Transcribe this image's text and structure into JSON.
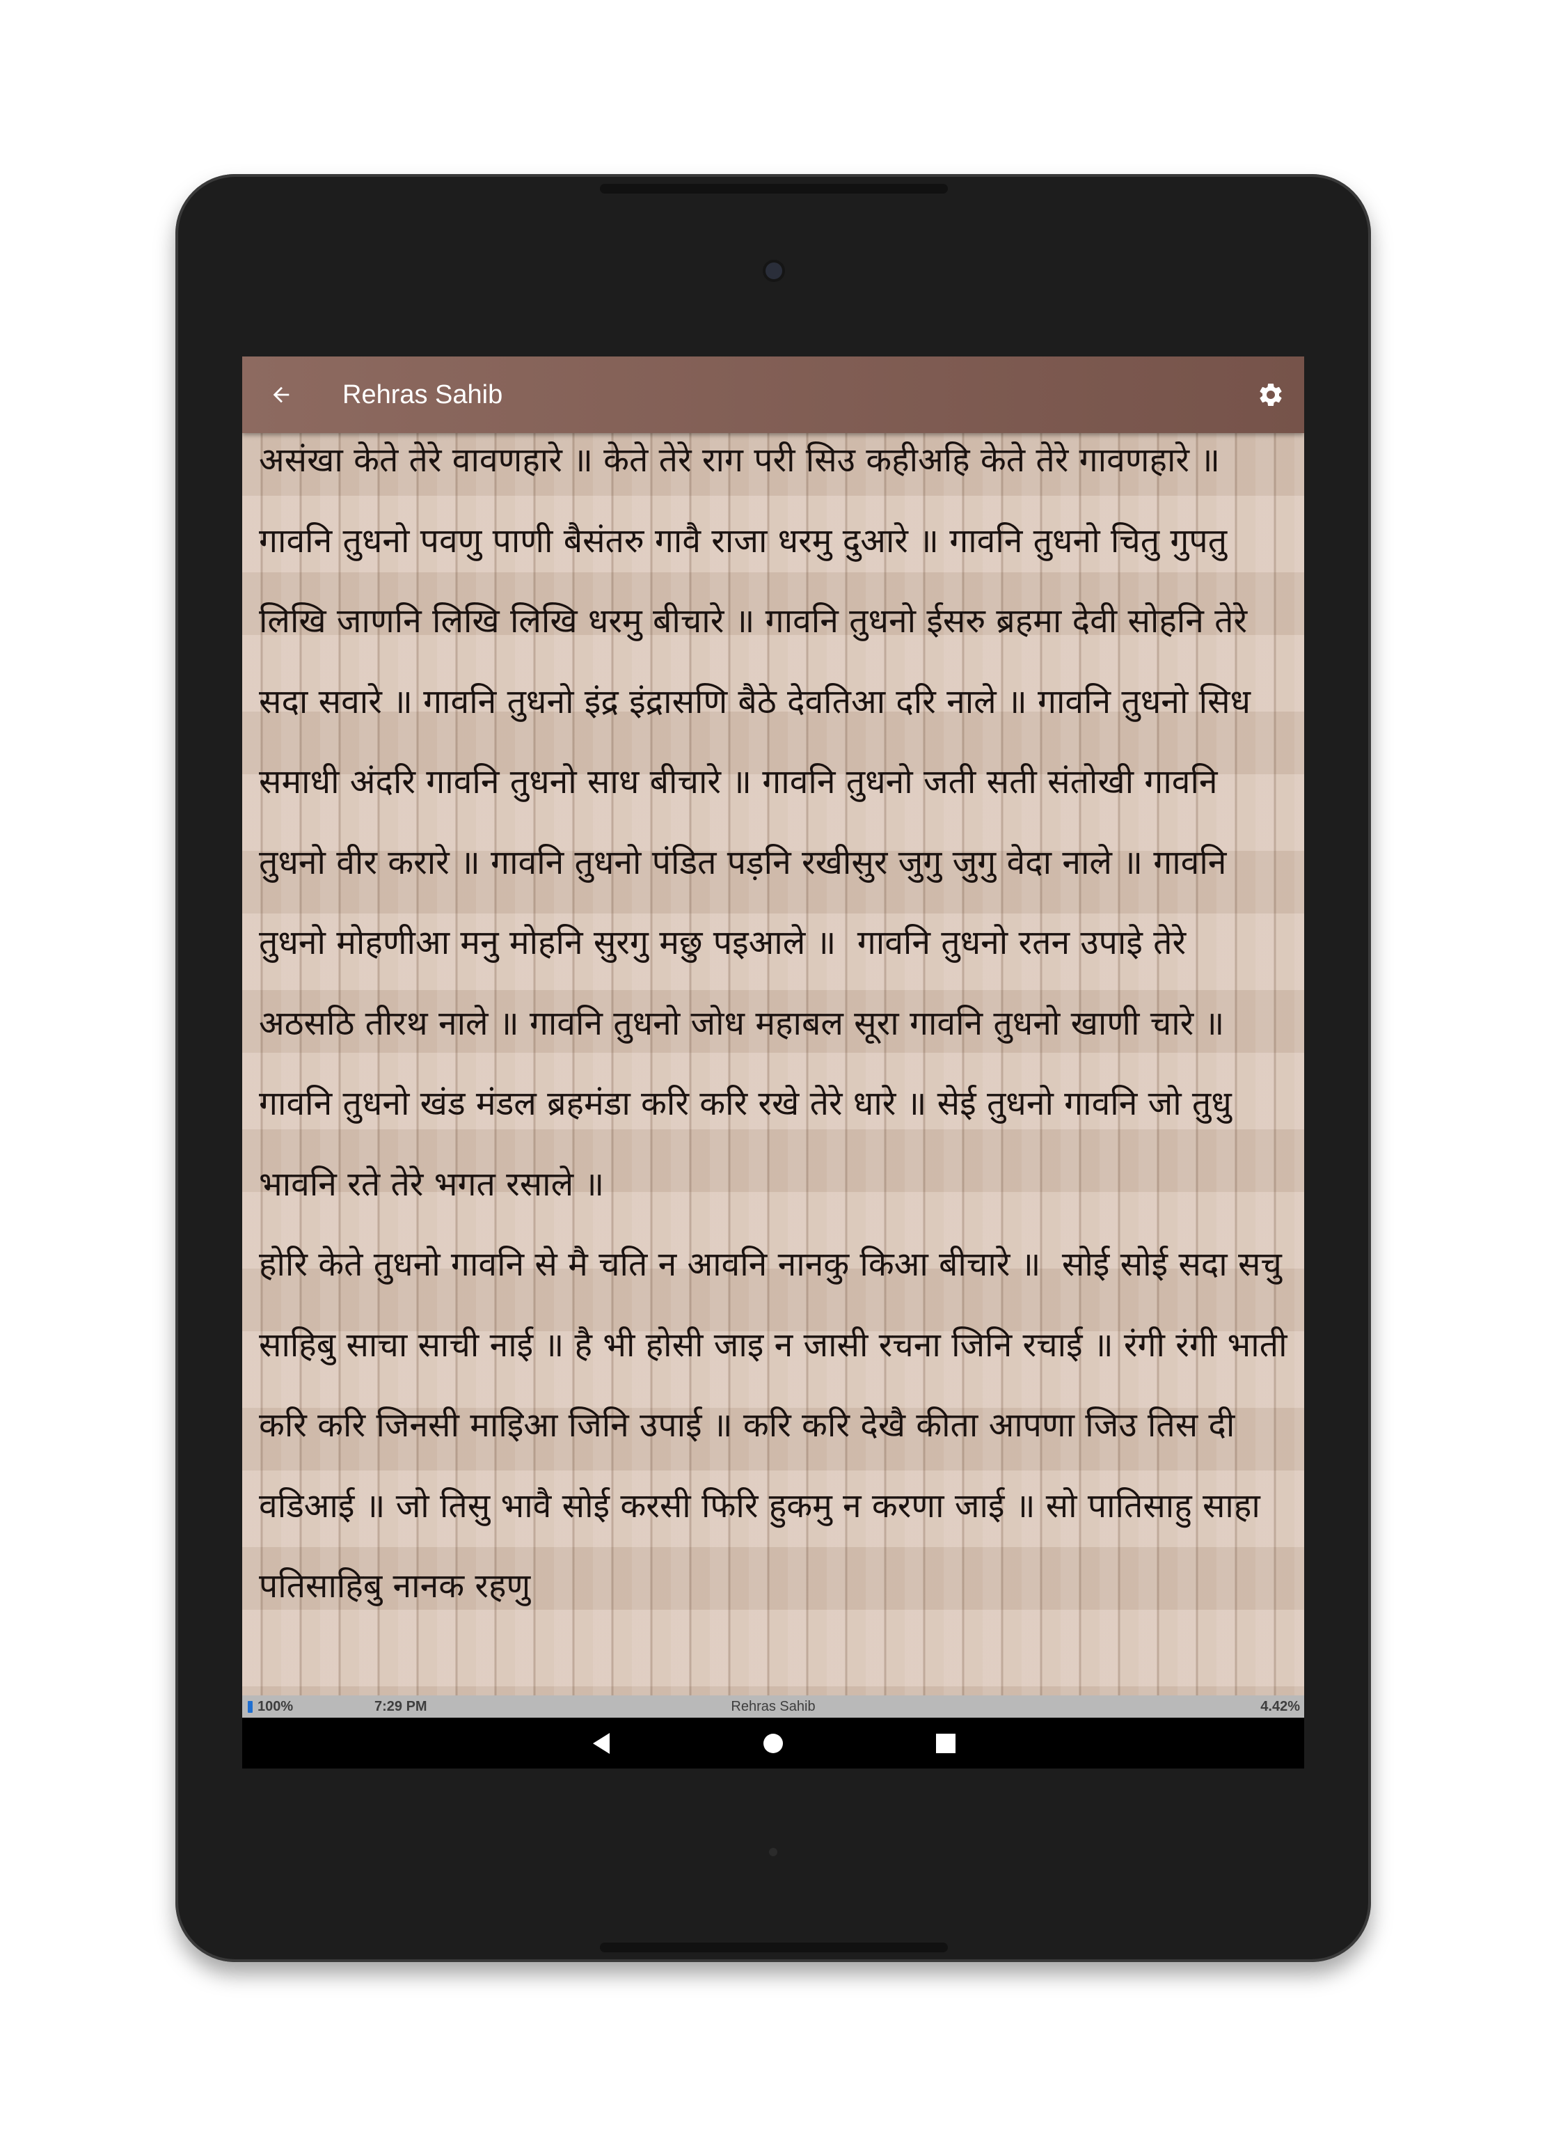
{
  "app": {
    "title": "Rehras Sahib"
  },
  "icons": {
    "back": "arrow-left-icon",
    "settings": "gear-icon",
    "battery": "battery-icon",
    "nav_back": "triangle-back-icon",
    "nav_home": "circle-home-icon",
    "nav_recents": "square-recents-icon"
  },
  "colors": {
    "toolbar": "#7f5d53",
    "page_background": "#d9c5b6",
    "text": "#1a1210",
    "status_strip": "#b9b9b9",
    "battery": "#1f6fd1"
  },
  "content": {
    "text": "असंखा केते तेरे वावणहारे ॥ केते तेरे राग परी सिउ कहीअहि केते तेरे गावणहारे ॥ गावनि तुधनो पवणु पाणी बैसंतरु गावै राजा धरमु दुआरे ॥ गावनि तुधनो चितु गुपतु लिखि जाणनि लिखि लिखि धरमु बीचारे ॥ गावनि तुधनो ईसरु ब्रहमा देवी सोहनि तेरे सदा सवारे ॥ गावनि तुधनो इंद्र इंद्रासणि बैठे देवतिआ दरि नाले ॥ गावनि तुधनो सिध समाधी अंदरि गावनि तुधनो साध बीचारे ॥ गावनि तुधनो जती सती संतोखी गावनि तुधनो वीर करारे ॥ गावनि तुधनो पंडित पड़नि रखीसुर जुगु जुगु वेदा नाले ॥ गावनि तुधनो मोहणीआ मनु मोहनि सुरगु मछु पइआले ॥  गावनि तुधनो रतन उपाइे तेरे अठसठि तीरथ नाले ॥ गावनि तुधनो जोध महाबल सूरा गावनि तुधनो खाणी चारे ॥ गावनि तुधनो खंड मंडल ब्रहमंडा करि करि रखे तेरे धारे ॥ सेई तुधनो गावनि जो तुधु भावनि रते तेरे भगत रसाले ॥\nहोरि केते तुधनो गावनि से मै चति न आवनि नानकु किआ बीचारे ॥  सोई सोई सदा सचु साहिबु साचा साची नाई ॥ है भी होसी जाइ न जासी रचना जिनि रचाई ॥ रंगी रंगी भाती करि करि जिनसी माइिआ जिनि उपाई ॥ करि करि देखै कीता आपणा जिउ तिस दी वडिआई ॥ जो तिसु भावै सोई करसी फिरि हुकमु न करणा जाई ॥ सो पातिसाहु साहा पतिसाहिबु नानक रहणु"
  },
  "status_bar": {
    "battery": "100%",
    "time": "7:29 PM",
    "title": "Rehras Sahib",
    "progress": "4.42%"
  }
}
